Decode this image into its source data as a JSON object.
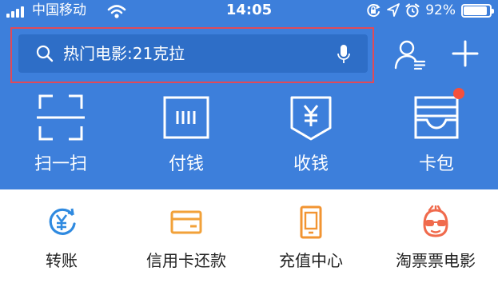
{
  "status_bar": {
    "carrier": "中国移动",
    "time": "14:05",
    "battery_percent": "92%",
    "battery_level": 0.92,
    "icons": [
      "signal-icon",
      "wifi-icon",
      "rotation-lock-icon",
      "location-icon",
      "alarm-icon",
      "battery-icon"
    ]
  },
  "search": {
    "placeholder": "热门电影:21克拉",
    "left_icon": "search-icon",
    "right_icon": "mic-icon"
  },
  "header_actions": {
    "contacts_icon": "contacts-icon",
    "add_icon": "plus-icon"
  },
  "top_actions": [
    {
      "label": "扫一扫",
      "icon": "scan-icon"
    },
    {
      "label": "付钱",
      "icon": "pay-code-icon"
    },
    {
      "label": "收钱",
      "icon": "receive-money-icon"
    },
    {
      "label": "卡包",
      "icon": "card-wallet-icon",
      "has_badge": true
    }
  ],
  "services": [
    {
      "label": "转账",
      "icon": "transfer-icon"
    },
    {
      "label": "信用卡还款",
      "icon": "credit-card-icon"
    },
    {
      "label": "充值中心",
      "icon": "phone-recharge-icon"
    },
    {
      "label": "淘票票电影",
      "icon": "movie-ticket-icon"
    }
  ],
  "colors": {
    "header_bg": "#3d7fdb",
    "search_bg": "#2e6ec7",
    "highlight_outline": "#e04a58",
    "badge": "#f5503c",
    "transfer_blue": "#2f8ae0",
    "credit_orange": "#f2a139",
    "recharge_orange": "#f29432",
    "movie_red": "#f06a4c"
  }
}
